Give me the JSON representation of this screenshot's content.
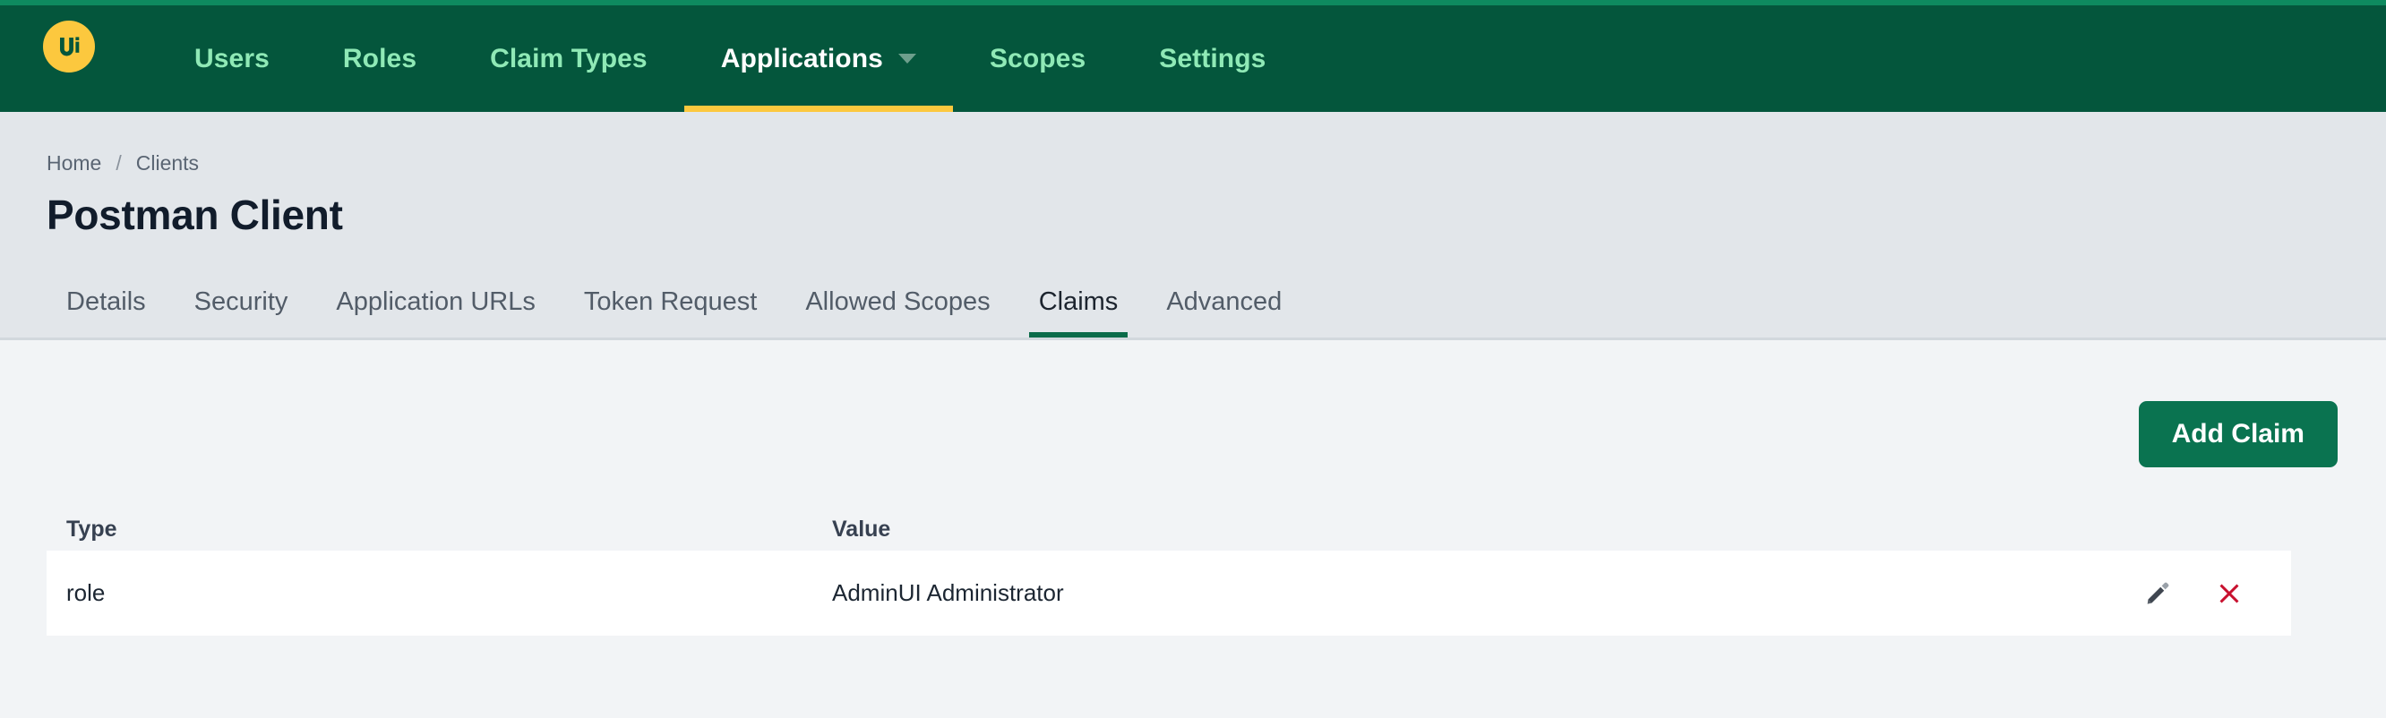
{
  "theme": {
    "nav_bg": "#04563c",
    "nav_accent_top": "#0e8a5f",
    "nav_link": "#8fe9b6",
    "nav_link_active": "#ffffff",
    "brand_yellow": "#fcc83e",
    "header_bg": "#e2e6ea",
    "content_bg": "#f2f4f6",
    "primary_green": "#0a7350",
    "tab_active_underline": "#0a6b49",
    "delete_red": "#c8102e",
    "edit_gray": "#3f4650"
  },
  "navbar": {
    "logo_icon": "ui-circle-logo",
    "logo_text": "Ui",
    "items": [
      {
        "label": "Users",
        "active": false,
        "has_caret": false
      },
      {
        "label": "Roles",
        "active": false,
        "has_caret": false
      },
      {
        "label": "Claim Types",
        "active": false,
        "has_caret": false
      },
      {
        "label": "Applications",
        "active": true,
        "has_caret": true,
        "caret_icon": "chevron-down-icon"
      },
      {
        "label": "Scopes",
        "active": false,
        "has_caret": false
      },
      {
        "label": "Settings",
        "active": false,
        "has_caret": false
      }
    ]
  },
  "page_header": {
    "breadcrumb": {
      "home": "Home",
      "separator": "/",
      "current": "Clients"
    },
    "title": "Postman Client",
    "tabs": [
      {
        "label": "Details",
        "active": false
      },
      {
        "label": "Security",
        "active": false
      },
      {
        "label": "Application URLs",
        "active": false
      },
      {
        "label": "Token Request",
        "active": false
      },
      {
        "label": "Allowed Scopes",
        "active": false
      },
      {
        "label": "Claims",
        "active": true
      },
      {
        "label": "Advanced",
        "active": false
      }
    ]
  },
  "content": {
    "add_claim_label": "Add Claim",
    "table": {
      "columns": [
        "Type",
        "Value"
      ],
      "rows": [
        {
          "type": "role",
          "value": "AdminUI Administrator",
          "edit_icon": "pencil-icon",
          "delete_icon": "close-x-icon"
        }
      ]
    }
  }
}
